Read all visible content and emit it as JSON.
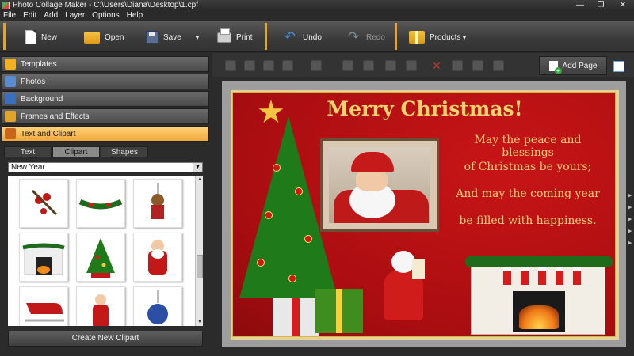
{
  "window": {
    "title": "Photo Collage Maker - C:\\Users\\Diana\\Desktop\\1.cpf",
    "controls": {
      "minimize": "—",
      "maximize": "❐",
      "close": "✕"
    }
  },
  "menu": [
    "File",
    "Edit",
    "Add",
    "Layer",
    "Options",
    "Help"
  ],
  "toolbar": {
    "new": "New",
    "open": "Open",
    "save": "Save",
    "print": "Print",
    "undo": "Undo",
    "redo": "Redo",
    "products": "Products",
    "dropdown_arrow": "▼"
  },
  "sidebar": {
    "sections": [
      {
        "label": "Templates",
        "icon": "star-icon",
        "active": false
      },
      {
        "label": "Photos",
        "icon": "photos-icon",
        "active": false
      },
      {
        "label": "Background",
        "icon": "background-icon",
        "active": false
      },
      {
        "label": "Frames and Effects",
        "icon": "frames-icon",
        "active": false
      },
      {
        "label": "Text and Clipart",
        "icon": "text-clipart-icon",
        "active": true
      }
    ],
    "subtabs": [
      {
        "label": "Text",
        "active": false
      },
      {
        "label": "Clipart",
        "active": true
      },
      {
        "label": "Shapes",
        "active": false
      }
    ],
    "category": "New Year",
    "clipart_items": [
      "berries-clipart",
      "garland-clipart",
      "reindeer-ornament-clipart",
      "fireplace-clipart",
      "christmas-tree-clipart",
      "santa-clipart",
      "sleigh-clipart",
      "santa-figure-clipart",
      "blue-bauble-clipart"
    ],
    "create_button": "Create New Clipart"
  },
  "editor_toolbar": {
    "add_page": "Add Page"
  },
  "card": {
    "title": "Merry Christmas!",
    "verse": [
      "May the peace and blessings",
      "of Christmas be yours;",
      "And may the coming year",
      "be filled with happiness."
    ]
  },
  "colors": {
    "accent": "#f2a93b",
    "card_red": "#b5100f",
    "title_gold": "#f3d36c"
  }
}
